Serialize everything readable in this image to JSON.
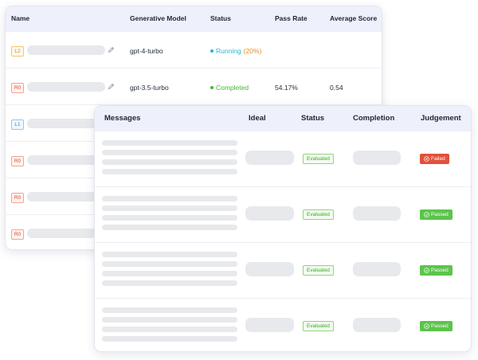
{
  "runs_table": {
    "headers": {
      "name": "Name",
      "model": "Generative Model",
      "status": "Status",
      "pass_rate": "Pass Rate",
      "average_score": "Average Score"
    },
    "rows": [
      {
        "level": "L2",
        "model": "gpt-4-turbo",
        "status": "Running",
        "progress": "(20%)",
        "pass_rate": "",
        "average_score": ""
      },
      {
        "level": "R0",
        "model": "gpt-3.5-turbo",
        "status": "Completed",
        "progress": "",
        "pass_rate": "54.17%",
        "average_score": "0.54"
      },
      {
        "level": "L1"
      },
      {
        "level": "R0"
      },
      {
        "level": "R0"
      },
      {
        "level": "R0"
      }
    ]
  },
  "evaluations_table": {
    "headers": {
      "messages": "Messages",
      "ideal": "Ideal",
      "status": "Status",
      "completion": "Completion",
      "judgement": "Judgement"
    },
    "rows": [
      {
        "status": "Evaluated",
        "judgement": "Failed"
      },
      {
        "status": "Evaluated",
        "judgement": "Passed"
      },
      {
        "status": "Evaluated",
        "judgement": "Passed"
      },
      {
        "status": "Evaluated",
        "judgement": "Passed"
      }
    ]
  },
  "colors": {
    "header_bg": "#eef0fb",
    "running": "#26b5d9",
    "progress": "#ee8b1d",
    "completed": "#43b82f",
    "failed": "#e2513a",
    "passed": "#5cc44c",
    "skeleton": "#e8e9ec"
  },
  "icons": {
    "edit": "pencil-icon",
    "failed": "close-circle-icon",
    "passed": "check-circle-icon"
  }
}
